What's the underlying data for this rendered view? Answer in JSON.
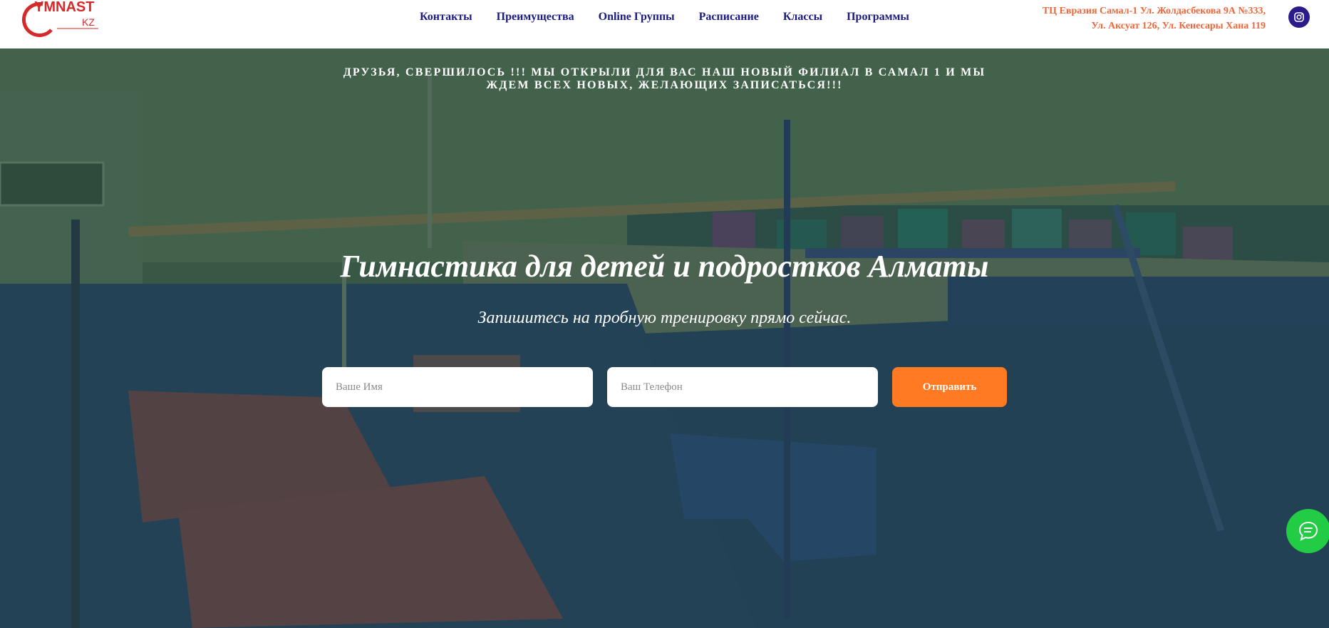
{
  "header": {
    "logo_text": "YMNAST",
    "logo_sub": "KZ",
    "nav": [
      {
        "label": "Контакты"
      },
      {
        "label": "Преимущества"
      },
      {
        "label": "Online Группы"
      },
      {
        "label": "Расписание"
      },
      {
        "label": "Классы"
      },
      {
        "label": "Программы"
      }
    ],
    "address_line1": "ТЦ Евразия Самал-1 Ул. Жолдасбекова 9А №333,",
    "address_line2": "Ул. Аксуат 126, Ул. Кенесары Хана 119",
    "social_icon": "instagram-icon"
  },
  "hero": {
    "announcement": "ДРУЗЬЯ, СВЕРШИЛОСЬ !!! МЫ ОТКРЫЛИ ДЛЯ ВАС НАШ НОВЫЙ ФИЛИАЛ В САМАЛ 1 И МЫ ЖДЕМ ВСЕХ НОВЫХ, ЖЕЛАЮЩИХ ЗАПИСАТЬСЯ!!!",
    "title": "Гимнастика для детей и подростков Алматы",
    "subtitle": "Запишитесь на пробную тренировку прямо сейчас.",
    "form": {
      "name_placeholder": "Ваше Имя",
      "phone_placeholder": "Ваш Телефон",
      "submit_label": "Отправить"
    }
  },
  "chat": {
    "icon": "chat-icon"
  },
  "colors": {
    "nav_text": "#1a1a80",
    "address": "#f0663a",
    "accent_button": "#ff7a22",
    "chat_button": "#22cc44",
    "instagram_bg": "#2a1a8a"
  }
}
